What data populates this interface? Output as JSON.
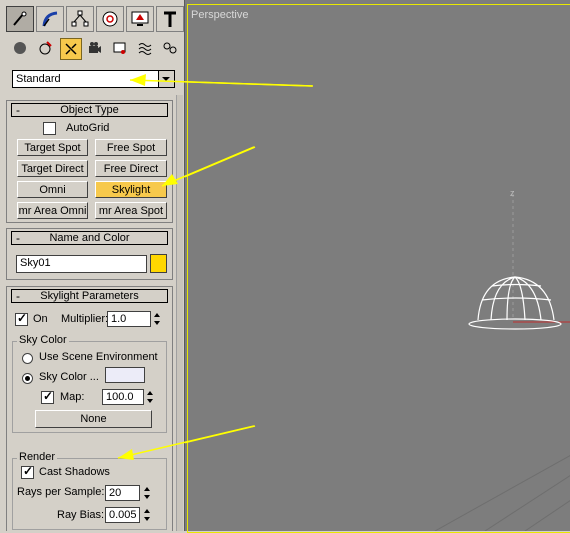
{
  "viewport": {
    "label": "Perspective",
    "axis_label": "z"
  },
  "command_tabs": [
    {
      "icon": "create-icon",
      "active": true
    },
    {
      "icon": "modify-icon"
    },
    {
      "icon": "hierarchy-icon"
    },
    {
      "icon": "motion-icon"
    },
    {
      "icon": "display-icon"
    },
    {
      "icon": "utilities-icon"
    }
  ],
  "subcategories": [
    {
      "icon": "geometry-icon"
    },
    {
      "icon": "shapes-icon"
    },
    {
      "icon": "lights-icon",
      "active": true
    },
    {
      "icon": "cameras-icon"
    },
    {
      "icon": "helpers-icon"
    },
    {
      "icon": "space-warps-icon"
    },
    {
      "icon": "systems-icon"
    }
  ],
  "category_dropdown": {
    "value": "Standard"
  },
  "object_type": {
    "title": "Object Type",
    "collapse": "-",
    "autogrid": "AutoGrid",
    "buttons": [
      "Target Spot",
      "Free Spot",
      "Target Direct",
      "Free Direct",
      "Omni",
      "Skylight",
      "mr Area Omni",
      "mr Area Spot"
    ],
    "active": "Skylight"
  },
  "name_color": {
    "title": "Name and Color",
    "collapse": "-",
    "name": "Sky01",
    "swatch": "#ffd700"
  },
  "skylight_params": {
    "title": "Skylight Parameters",
    "collapse": "-",
    "on_label": "On",
    "multiplier_label": "Multiplier:",
    "multiplier": "1.0",
    "sky_color_group": "Sky Color",
    "use_scene_env": "Use Scene Environment",
    "sky_color": "Sky Color ...",
    "sky_color_swatch": "#ececf8",
    "map_label": "Map:",
    "map_value": "100.0",
    "map_button": "None",
    "render_group": "Render",
    "cast_shadows": "Cast Shadows",
    "rays_label": "Rays per Sample:",
    "rays": "20",
    "bias_label": "Ray Bias:",
    "bias": "0.005"
  },
  "colors": {
    "highlight": "#f7c94c",
    "arrow": "#ffff00",
    "viewport_bg": "#7d7d7d"
  }
}
